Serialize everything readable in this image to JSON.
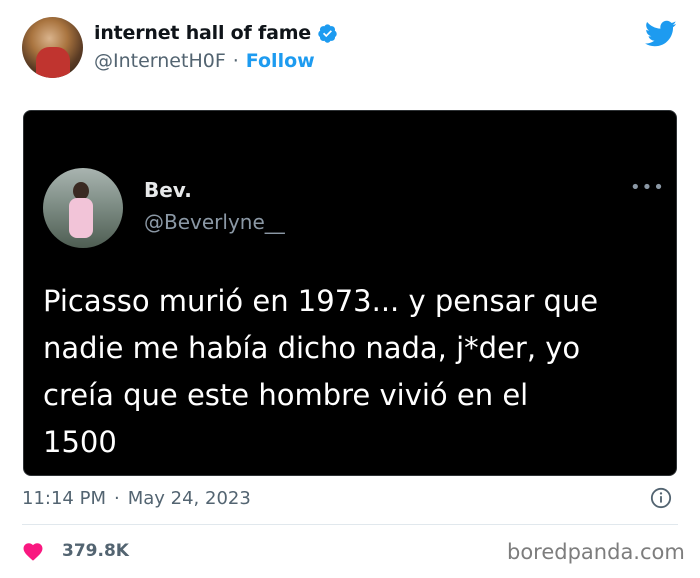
{
  "author": {
    "display_name": "internet hall of fame",
    "handle": "@InternetH0F",
    "separator": "·",
    "follow_label": "Follow",
    "verified_color": "#1d9bf0"
  },
  "embedded_tweet": {
    "display_name": "Bev.",
    "handle": "@Beverlyne__",
    "more_label": "•••",
    "lines": [
      "Picasso murió en 1973... y  pensar que",
      "nadie me había dicho nada, j*der, yo",
      "creía que este hombre vivió en el",
      "1500"
    ]
  },
  "meta": {
    "time": "11:14 PM",
    "separator": "·",
    "date": "May 24, 2023"
  },
  "engagement": {
    "likes": "379.8K",
    "heart_color": "#f91880"
  },
  "watermark": "boredpanda.com",
  "icons": {
    "verified": "verified-badge-icon",
    "brand": "twitter-bird-icon",
    "info": "info-icon",
    "like": "heart-icon",
    "more": "more-options-icon"
  },
  "colors": {
    "accent": "#1d9bf0",
    "secondary_text": "#536471",
    "card_background": "#000000"
  }
}
